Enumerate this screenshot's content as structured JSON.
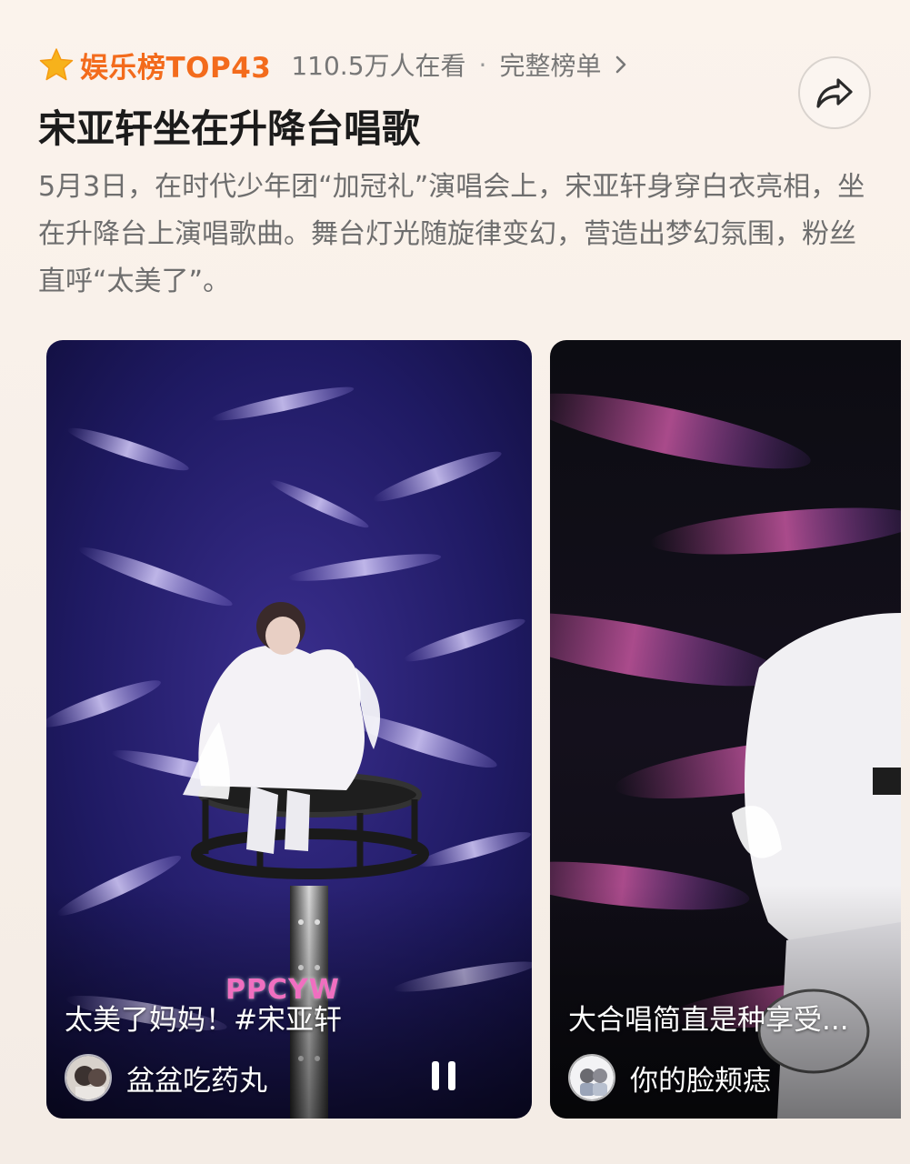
{
  "topic": {
    "rank_label": "娱乐榜TOP43",
    "viewers": "110.5万人在看",
    "separator": "·",
    "full_list_label": "完整榜单",
    "title": "宋亚轩坐在升降台唱歌",
    "summary": "5月3日，在时代少年团“加冠礼”演唱会上，宋亚轩身穿白衣亮相，坐在升降台上演唱歌曲。舞台灯光随旋律变幻，营造出梦幻氛围，粉丝直呼“太美了”。"
  },
  "colors": {
    "accent_orange": "#f36b1c",
    "star_yellow": "#f7b21b",
    "text_gray": "#6e6e6e",
    "title_black": "#1b1b1b"
  },
  "icons": {
    "rank": "star-icon",
    "full_list": "chevron-right-icon",
    "share": "share-arrow-icon",
    "play_state": "pause-icon"
  },
  "videos": [
    {
      "caption": "太美了妈妈！#宋亚轩",
      "watermark": "PPCYW",
      "author": "盆盆吃药丸",
      "state": "playing"
    },
    {
      "caption": "大合唱简直是种享受...",
      "author": "你的脸颊痣"
    }
  ]
}
